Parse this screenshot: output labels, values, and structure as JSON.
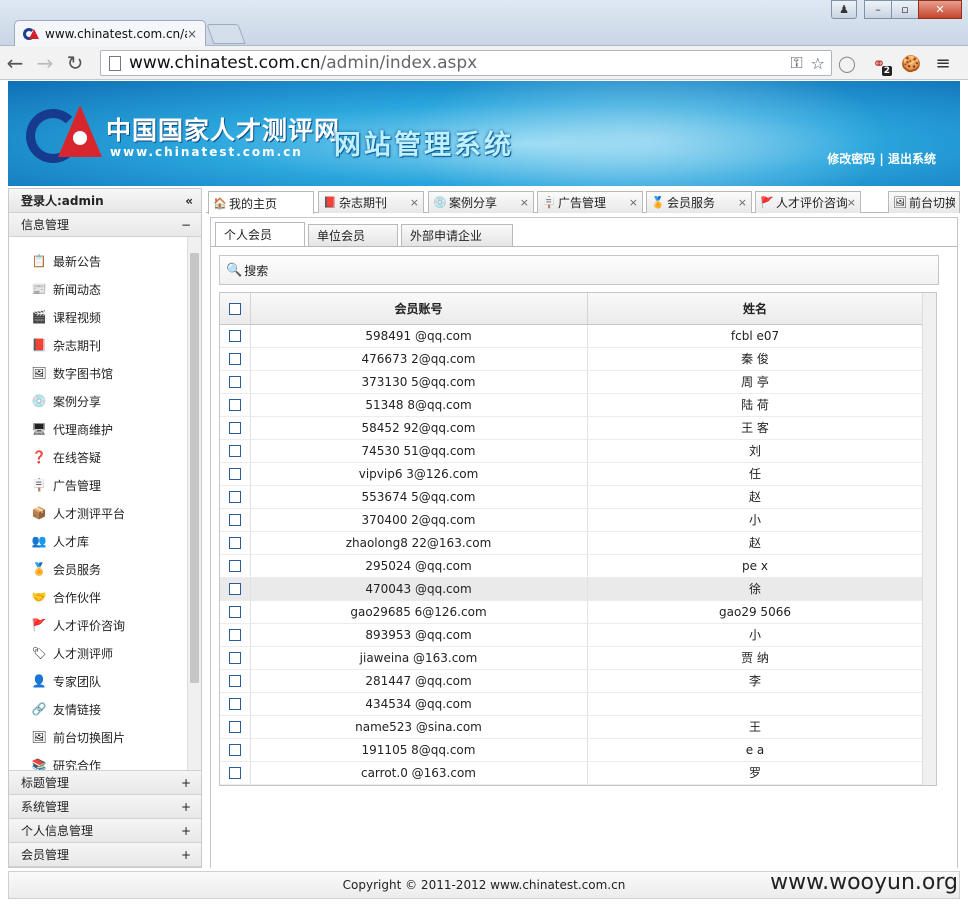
{
  "browser": {
    "tab_title": "www.chinatest.com.cn/a",
    "tab_close": "×",
    "url_host": "www.chinatest.com.cn",
    "url_path": "/admin/index.aspx",
    "window_buttons": {
      "user": "♟",
      "minimize": "–",
      "maximize": "▫",
      "close": "✕"
    },
    "nav": {
      "back": "←",
      "forward": "→",
      "reload": "↻"
    },
    "ext_badge": "2"
  },
  "header": {
    "site_name_cn": "中国国家人才测评网",
    "site_name_en": "www.chinatest.com.cn",
    "system_title": "网站管理系统",
    "change_password": "修改密码",
    "separator": "|",
    "logout": "退出系统"
  },
  "sidebar": {
    "login_label": "登录人:admin",
    "collapse_icon": "«",
    "active_group": {
      "label": "信息管理",
      "toggle": "−"
    },
    "items": [
      {
        "label": "最新公告",
        "icon": "notepad-icon",
        "glyph": "📋"
      },
      {
        "label": "新闻动态",
        "icon": "newspaper-icon",
        "glyph": "📰"
      },
      {
        "label": "课程视频",
        "icon": "film-icon",
        "glyph": "🎬"
      },
      {
        "label": "杂志期刊",
        "icon": "book-icon",
        "glyph": "📕"
      },
      {
        "label": "数字图书馆",
        "icon": "picture-icon",
        "glyph": "🖼"
      },
      {
        "label": "案例分享",
        "icon": "share-icon",
        "glyph": "💿"
      },
      {
        "label": "代理商维护",
        "icon": "monitor-icon",
        "glyph": "🖥"
      },
      {
        "label": "在线答疑",
        "icon": "help-icon",
        "glyph": "❓"
      },
      {
        "label": "广告管理",
        "icon": "billboard-icon",
        "glyph": "🪧"
      },
      {
        "label": "人才测评平台",
        "icon": "box-icon",
        "glyph": "📦"
      },
      {
        "label": "人才库",
        "icon": "users-icon",
        "glyph": "👥"
      },
      {
        "label": "会员服务",
        "icon": "medal-icon",
        "glyph": "🏅"
      },
      {
        "label": "合作伙伴",
        "icon": "partner-icon",
        "glyph": "🤝"
      },
      {
        "label": "人才评价咨询",
        "icon": "flag-icon",
        "glyph": "🚩"
      },
      {
        "label": "人才测评师",
        "icon": "tag-icon",
        "glyph": "🏷"
      },
      {
        "label": "专家团队",
        "icon": "expert-icon",
        "glyph": "👤"
      },
      {
        "label": "友情链接",
        "icon": "link-icon",
        "glyph": "🔗"
      },
      {
        "label": "前台切换图片",
        "icon": "slides-icon",
        "glyph": "🖼"
      },
      {
        "label": "研究合作",
        "icon": "research-icon",
        "glyph": "📚"
      }
    ],
    "groups": [
      {
        "label": "标题管理",
        "toggle": "+"
      },
      {
        "label": "系统管理",
        "toggle": "+"
      },
      {
        "label": "个人信息管理",
        "toggle": "+"
      },
      {
        "label": "会员管理",
        "toggle": "+"
      }
    ]
  },
  "main_tabs": [
    {
      "label": "我的主页",
      "icon": "home-icon",
      "glyph": "🏠",
      "close": ""
    },
    {
      "label": "杂志期刊",
      "icon": "book-icon",
      "glyph": "📕",
      "close": "×"
    },
    {
      "label": "案例分享",
      "icon": "share-icon",
      "glyph": "💿",
      "close": "×"
    },
    {
      "label": "广告管理",
      "icon": "billboard-icon",
      "glyph": "🪧",
      "close": "×"
    },
    {
      "label": "会员服务",
      "icon": "medal-icon",
      "glyph": "🏅",
      "close": "×"
    },
    {
      "label": "人才评价咨询",
      "icon": "flag-icon",
      "glyph": "🚩",
      "close": "×"
    },
    {
      "label": "前台切换",
      "icon": "slides-icon",
      "glyph": "🖼",
      "close": ""
    }
  ],
  "sub_tabs": [
    "个人会员",
    "单位会员",
    "外部申请企业"
  ],
  "search": {
    "label": "搜索"
  },
  "table": {
    "headers": [
      "会员账号",
      "姓名"
    ],
    "rows": [
      [
        "598491   @qq.com",
        "fcbl    e07"
      ],
      [
        "476673   2@qq.com",
        "秦   俊"
      ],
      [
        "373130   5@qq.com",
        "周   亭"
      ],
      [
        "51348   8@qq.com",
        "陆   荷"
      ],
      [
        "58452   92@qq.com",
        "王   客"
      ],
      [
        "74530   51@qq.com",
        "刘   "
      ],
      [
        "vipvip6   3@126.com",
        "任   "
      ],
      [
        "553674   5@qq.com",
        "赵   "
      ],
      [
        "370400   2@qq.com",
        "小   "
      ],
      [
        "zhaolong8   22@163.com",
        "赵   "
      ],
      [
        "295024   @qq.com",
        "pe   x"
      ],
      [
        "470043   @qq.com",
        "徐   "
      ],
      [
        "gao29685   6@126.com",
        "gao29   5066"
      ],
      [
        "893953   @qq.com",
        "小   "
      ],
      [
        "jiaweina   @163.com",
        "贾   纳"
      ],
      [
        "281447   @qq.com",
        "李   "
      ],
      [
        "434534   @qq.com",
        "   "
      ],
      [
        "name523   @sina.com",
        "王   "
      ],
      [
        "191105   8@qq.com",
        "e   a"
      ],
      [
        "carrot.0   @163.com",
        "罗   "
      ]
    ],
    "highlight_row": 11
  },
  "footer": {
    "copyright": "Copyright © 2011-2012 www.chinatest.com.cn"
  },
  "watermark": "www.wooyun.org"
}
